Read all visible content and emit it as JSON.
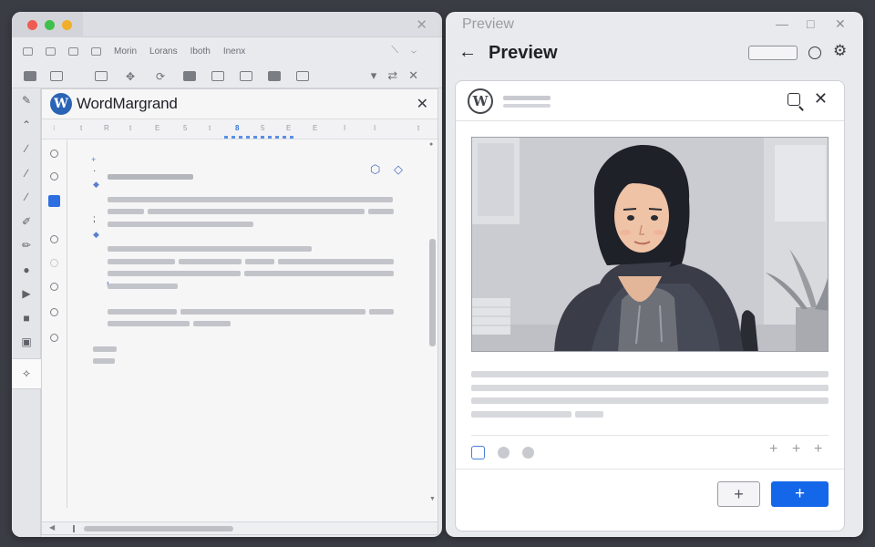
{
  "editor": {
    "menu": [
      "Morin",
      "Lorans",
      "Iboth",
      "Inenx"
    ],
    "doc_title": "WordMargrand",
    "ruler_ticks": [
      "⁝",
      "t",
      "R",
      "t",
      "E",
      "5",
      "t",
      "8",
      "5",
      "E",
      "E",
      "I",
      "I",
      "t"
    ]
  },
  "preview": {
    "window_title": "Preview",
    "header_title": "Preview",
    "logo_letter": "W"
  },
  "glyphs": {
    "close": "✕",
    "plus": "+",
    "back": "←",
    "gear": "⚙"
  },
  "colors": {
    "accent": "#1467e8",
    "brand_blue": "#2b64b5"
  }
}
